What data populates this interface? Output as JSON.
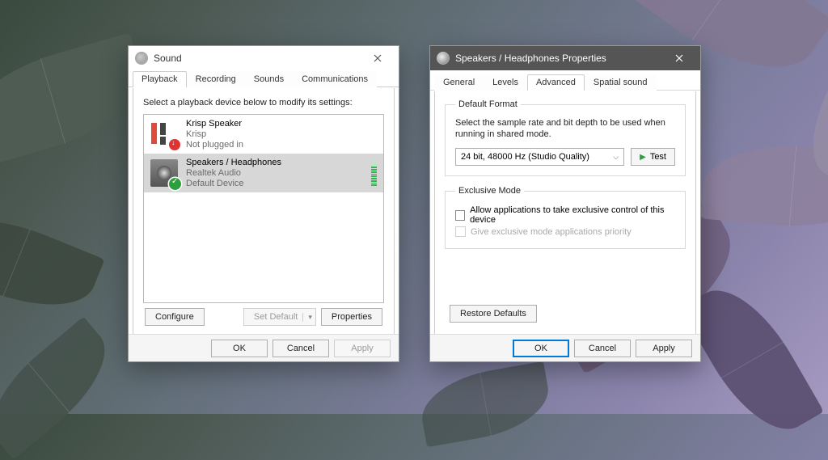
{
  "sound_window": {
    "title": "Sound",
    "tabs": [
      "Playback",
      "Recording",
      "Sounds",
      "Communications"
    ],
    "active_tab": 0,
    "instruction": "Select a playback device below to modify its settings:",
    "devices": [
      {
        "name": "Krisp Speaker",
        "driver": "Krisp",
        "status": "Not plugged in"
      },
      {
        "name": "Speakers / Headphones",
        "driver": "Realtek Audio",
        "status": "Default Device"
      }
    ],
    "buttons": {
      "configure": "Configure",
      "set_default": "Set Default",
      "properties": "Properties",
      "ok": "OK",
      "cancel": "Cancel",
      "apply": "Apply"
    }
  },
  "props_window": {
    "title": "Speakers / Headphones Properties",
    "tabs": [
      "General",
      "Levels",
      "Advanced",
      "Spatial sound"
    ],
    "active_tab": 2,
    "default_format": {
      "legend": "Default Format",
      "text": "Select the sample rate and bit depth to be used when running in shared mode.",
      "value": "24 bit, 48000 Hz (Studio Quality)",
      "test": "Test"
    },
    "exclusive_mode": {
      "legend": "Exclusive Mode",
      "opt1": "Allow applications to take exclusive control of this device",
      "opt2": "Give exclusive mode applications priority"
    },
    "buttons": {
      "restore": "Restore Defaults",
      "ok": "OK",
      "cancel": "Cancel",
      "apply": "Apply"
    }
  }
}
